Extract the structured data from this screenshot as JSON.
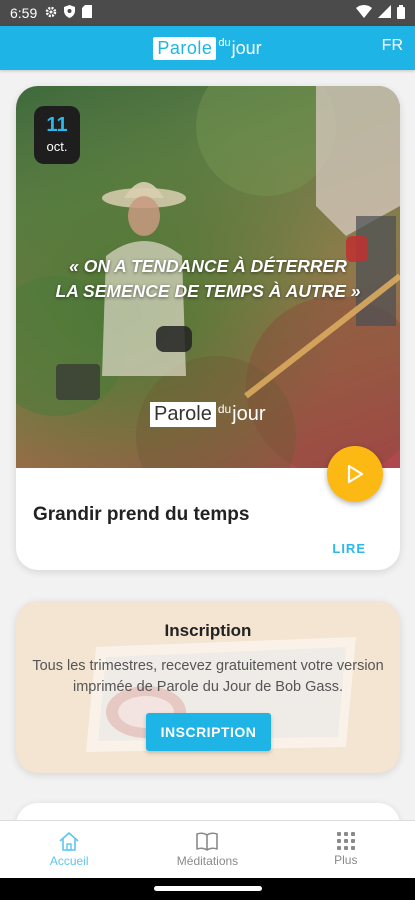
{
  "status_bar": {
    "time": "6:59"
  },
  "app_bar": {
    "logo_main": "Parole",
    "logo_du": "du",
    "logo_jour": "jour",
    "language": "FR"
  },
  "daily": {
    "day": "11",
    "month": "oct.",
    "quote_line1": "« ON A TENDANCE À DÉTERRER",
    "quote_line2": "LA SEMENCE DE TEMPS À AUTRE »",
    "title": "Grandir prend du temps",
    "read_label": "LIRE"
  },
  "subscription": {
    "title": "Inscription",
    "text": "Tous les trimestres, recevez gratuitement votre version imprimée de Parole du Jour de Bob Gass.",
    "button_label": "INSCRIPTION"
  },
  "bottom_nav": [
    {
      "label": "Accueil",
      "icon": "home-icon",
      "active": true
    },
    {
      "label": "Méditations",
      "icon": "book-icon",
      "active": false
    },
    {
      "label": "Plus",
      "icon": "grid-icon",
      "active": false
    }
  ],
  "colors": {
    "primary": "#1eb4e6",
    "accent": "#fdb913",
    "status_bar": "#4b4b4b"
  }
}
